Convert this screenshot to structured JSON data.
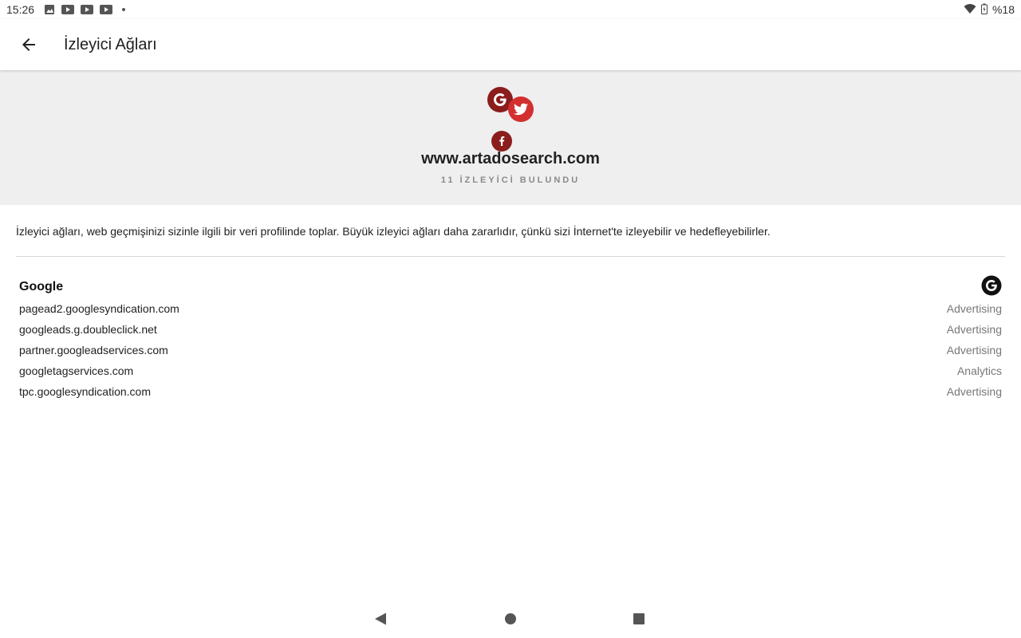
{
  "status_bar": {
    "time": "15:26",
    "notification_icons": [
      "image-icon",
      "youtube-icon",
      "youtube-icon",
      "youtube-icon",
      "dot-icon"
    ],
    "battery": "%18",
    "icons": [
      "wifi-icon",
      "battery-icon"
    ]
  },
  "app_bar": {
    "title": "İzleyici Ağları",
    "back_icon": "arrow-back-icon"
  },
  "hero": {
    "domain": "www.artadosearch.com",
    "tracker_count_text": "11 İZLEYİCİ BULUNDU",
    "icons": [
      "google-icon",
      "twitter-icon",
      "facebook-icon"
    ],
    "colors": {
      "dark_red": "#8b1d1d",
      "red": "#d32f2f",
      "background": "#efefef"
    }
  },
  "description": "İzleyici ağları, web geçmişinizi sizinle ilgili bir veri profilinde toplar. Büyük izleyici ağları daha zararlıdır, çünkü sizi İnternet'te izleyebilir ve hedefleyebilirler.",
  "networks": [
    {
      "name": "Google",
      "icon": "google-icon",
      "trackers": [
        {
          "domain": "pagead2.googlesyndication.com",
          "category": "Advertising"
        },
        {
          "domain": "googleads.g.doubleclick.net",
          "category": "Advertising"
        },
        {
          "domain": "partner.googleadservices.com",
          "category": "Advertising"
        },
        {
          "domain": "googletagservices.com",
          "category": "Analytics"
        },
        {
          "domain": "tpc.googlesyndication.com",
          "category": "Advertising"
        }
      ]
    }
  ],
  "nav_bar": {
    "icons": [
      "nav-back-icon",
      "nav-home-icon",
      "nav-recents-icon"
    ]
  }
}
